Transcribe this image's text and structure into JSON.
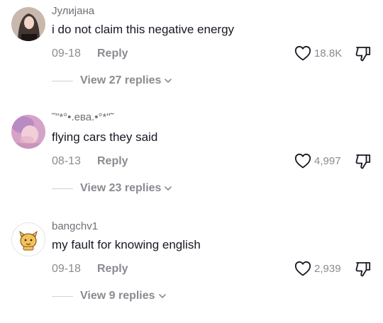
{
  "comments": [
    {
      "username": "Јулијана",
      "text": "i do not claim this negative energy",
      "date": "09-18",
      "reply_label": "Reply",
      "likes": "18.8K",
      "view_replies": "View 27 replies",
      "avatar": "avatar-photo-dark-hair"
    },
    {
      "username": "˜\"*°•.ева.•°*\"˜",
      "text": "flying cars they said",
      "date": "08-13",
      "reply_label": "Reply",
      "likes": "4,997",
      "view_replies": "View 23 replies",
      "avatar": "avatar-photo-pink"
    },
    {
      "username": "bangchv1",
      "text": "my fault for knowing english",
      "date": "09-18",
      "reply_label": "Reply",
      "likes": "2,939",
      "view_replies": "View 9 replies",
      "avatar": "avatar-cartoon-character"
    }
  ],
  "icons": {
    "like": "heart-outline-icon",
    "dislike": "thumbs-down-outline-icon",
    "expand": "chevron-down-icon"
  },
  "colors": {
    "primary_text": "#161823",
    "secondary_text": "#8a8b91",
    "divider": "#d0d1d3"
  }
}
